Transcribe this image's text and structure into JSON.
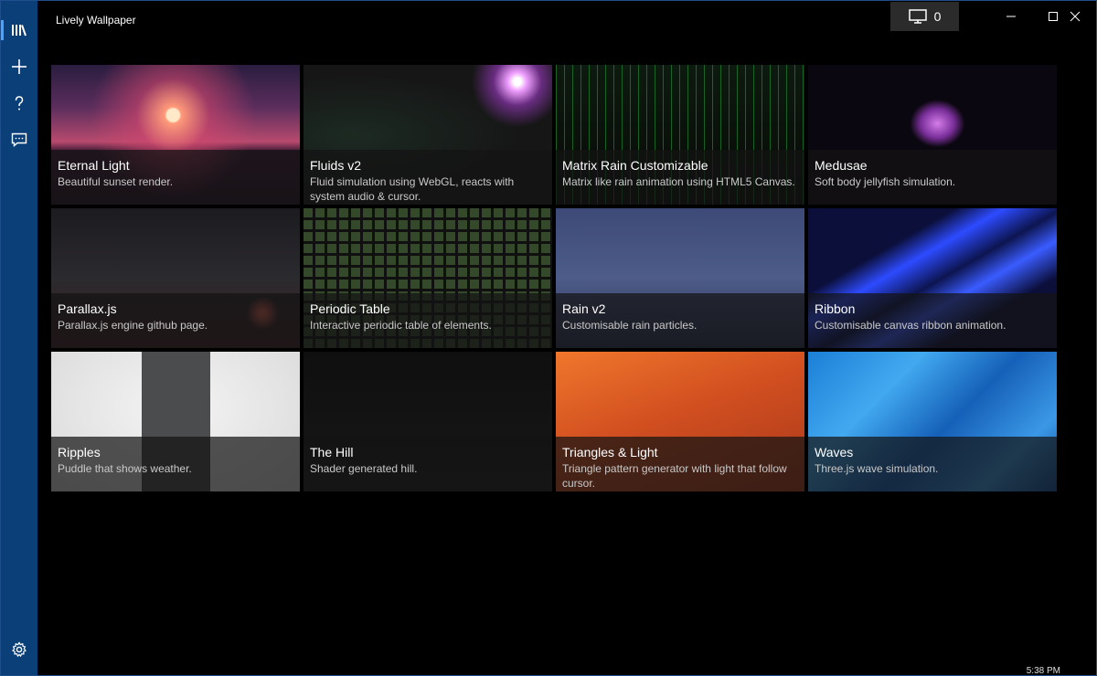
{
  "window": {
    "title": "Lively Wallpaper"
  },
  "header": {
    "display_count": "0"
  },
  "sidebar": {
    "items": [
      {
        "name": "library",
        "icon": "library-icon"
      },
      {
        "name": "add",
        "icon": "plus-icon"
      },
      {
        "name": "help",
        "icon": "question-icon"
      },
      {
        "name": "feedback",
        "icon": "chat-icon"
      }
    ],
    "settings_icon": "gear-icon"
  },
  "wallpapers": [
    {
      "title": "Eternal Light",
      "desc": "Beautiful sunset render."
    },
    {
      "title": "Fluids v2",
      "desc": "Fluid simulation using WebGL, reacts with system audio & cursor."
    },
    {
      "title": "Matrix Rain Customizable",
      "desc": "Matrix like rain animation using HTML5 Canvas."
    },
    {
      "title": "Medusae",
      "desc": "Soft body jellyfish simulation."
    },
    {
      "title": "Parallax.js",
      "desc": "Parallax.js engine github page."
    },
    {
      "title": "Periodic Table",
      "desc": "Interactive periodic table of elements."
    },
    {
      "title": "Rain v2",
      "desc": "Customisable rain particles."
    },
    {
      "title": "Ribbon",
      "desc": "Customisable canvas ribbon animation."
    },
    {
      "title": "Ripples",
      "desc": "Puddle that shows weather."
    },
    {
      "title": "The Hill",
      "desc": "Shader generated hill."
    },
    {
      "title": "Triangles & Light",
      "desc": "Triangle pattern generator with light that follow cursor."
    },
    {
      "title": "Waves",
      "desc": "Three.js wave simulation."
    }
  ],
  "taskbar": {
    "clock": "5:38 PM"
  },
  "colors": {
    "sidebar": "#0a3f77",
    "accent": "#4aa3ff"
  }
}
